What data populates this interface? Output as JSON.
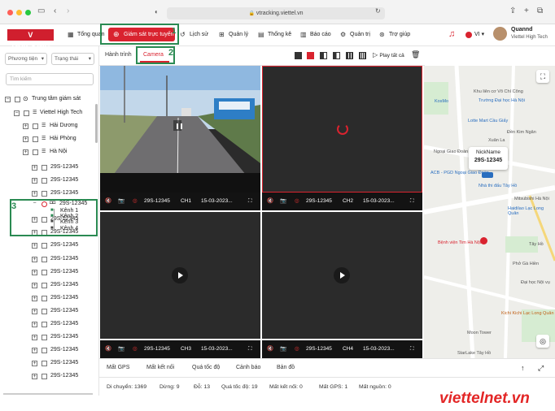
{
  "browser": {
    "url": "vtracking.viettel.vn"
  },
  "app": {
    "logo": "V TRACKING",
    "user_name": "Quannd",
    "user_org": "Viettel High Tech",
    "lang": "VI"
  },
  "nav": [
    {
      "label": "Tổng quan"
    },
    {
      "label": "Giám sát trực tuyến"
    },
    {
      "label": "Lịch sử"
    },
    {
      "label": "Quản lý"
    },
    {
      "label": "Thống kê"
    },
    {
      "label": "Báo cáo"
    },
    {
      "label": "Quản trị"
    },
    {
      "label": "Trợ giúp"
    }
  ],
  "filters": {
    "vehicle": "Phương tiện",
    "status": "Trạng thái",
    "search_placeholder": "Tìm kiếm"
  },
  "tree": {
    "root": "Trung tâm giám sát",
    "company": "Viettel High Tech",
    "groups": [
      "Hải Dương",
      "Hải Phòng",
      "Hà Nội"
    ],
    "vehicle": "29S-12345",
    "channels": [
      "Kênh 1",
      "Kênh 2",
      "Kênh 3",
      "Kênh 4"
    ]
  },
  "tabs": {
    "route": "Hành trình",
    "camera": "Camera",
    "play_all": "Play tất cả"
  },
  "videos": [
    {
      "plate": "29S-12345",
      "ch": "CH1",
      "date": "15-03-2023..."
    },
    {
      "plate": "29S-12345",
      "ch": "CH2",
      "date": "15-03-2023..."
    },
    {
      "plate": "29S-12345",
      "ch": "CH3",
      "date": "15-03-2023..."
    },
    {
      "plate": "29S-12345",
      "ch": "CH4",
      "date": "15-03-2023..."
    }
  ],
  "map": {
    "nickname": "NickName",
    "plate": "29S-12345",
    "labels": [
      "Khu liên cơ Võ Chí Công",
      "Trường Đại học Hà Nội",
      "Lotte Mart Cầu Giấy",
      "Bệnh viện Tim Hà Nội 2",
      "Phở Gà Hiền",
      "Kichi Kichi Lạc Long Quân",
      "Moon Tower",
      "StarLake Tây Hồ",
      "Nhà thi đấu Tây Hồ",
      "Haidilao Lạc Long Quân",
      "Đại học Nội vụ",
      "Mitsubishi Hà Nội",
      "ACB - PGD Ngoại Giao Đoàn",
      "KosMo",
      "Đền Kim Ngân",
      "Ngoại Giao Đoàn",
      "Tây Hồ",
      "Xuân La"
    ]
  },
  "bottom_tabs": [
    "Mất GPS",
    "Mất kết nối",
    "Quá tốc độ",
    "Cảnh báo",
    "Bản đồ"
  ],
  "stats": [
    "Di chuyển: 1369",
    "Dừng: 9",
    "Đỗ: 13",
    "Quá tốc độ: 19",
    "Mất kết nối: 0",
    "Mất GPS: 1",
    "Mất nguồn: 0"
  ],
  "annotations": [
    "1",
    "2",
    "3"
  ],
  "watermark": "viettelnet.vn"
}
